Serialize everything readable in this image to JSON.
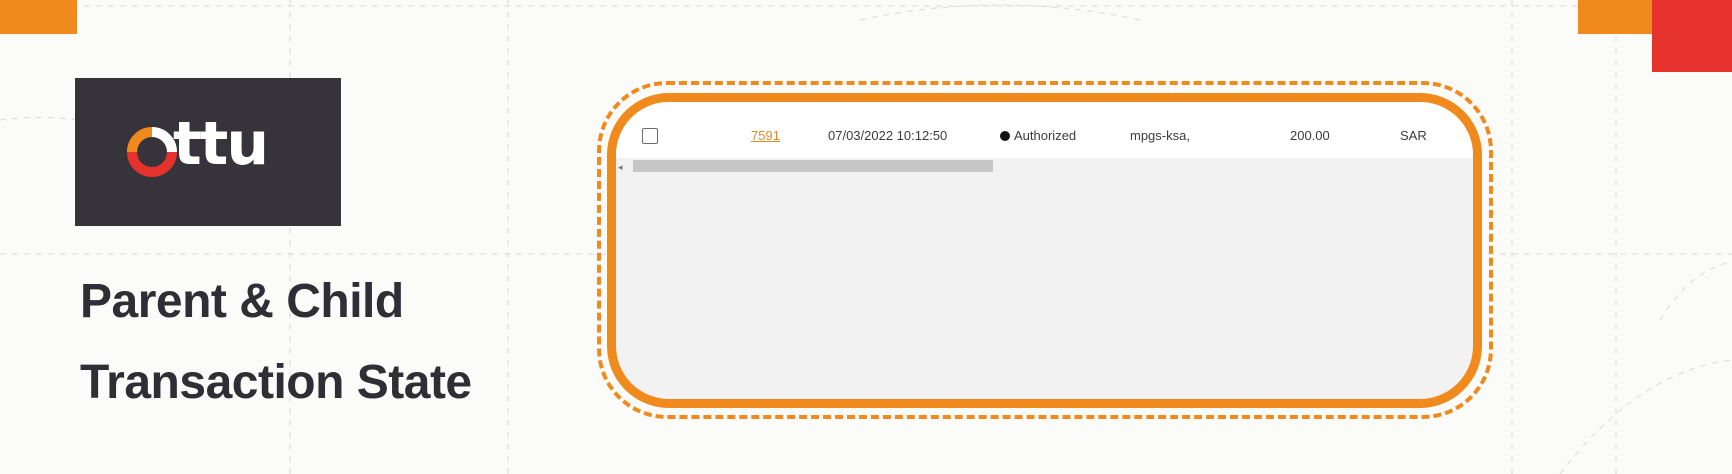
{
  "logo": {
    "text": "ttu",
    "icon": "ottu-o-ring-icon"
  },
  "headline": {
    "line1": "Parent & Child",
    "line2": "Transaction State"
  },
  "transaction": {
    "id": "7591",
    "date": "07/03/2022 10:12:50",
    "state": "Authorized",
    "gateway": "mpgs-ksa,",
    "amount": "200.00",
    "currency": "SAR"
  },
  "colors": {
    "brand_orange": "#f08a1c",
    "brand_red": "#e5322d",
    "dark": "#36343a",
    "link": "#e08a2a"
  }
}
